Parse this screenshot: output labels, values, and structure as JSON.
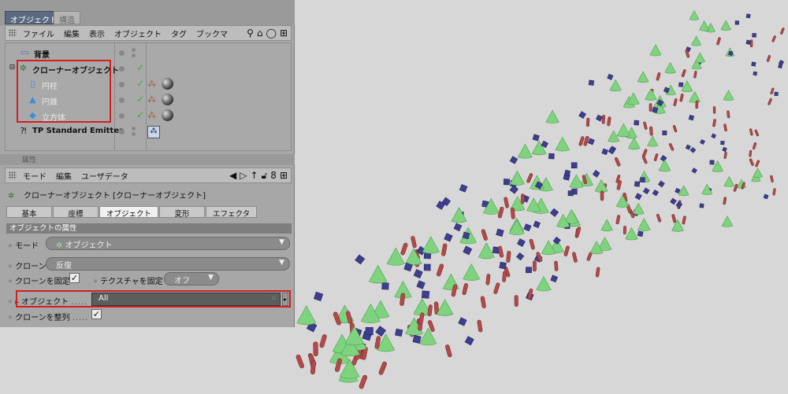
{
  "object_manager": {
    "tabs": [
      "オブジェクト",
      "構造"
    ],
    "menu": [
      "ファイル",
      "編集",
      "表示",
      "オブジェクト",
      "タグ",
      "ブックマ"
    ],
    "tree": [
      {
        "name": "背景",
        "icon": "background-icon"
      },
      {
        "name": "クローナーオブジェクト",
        "icon": "cloner-icon"
      },
      {
        "name": "円柱",
        "icon": "cylinder-icon"
      },
      {
        "name": "円錐",
        "icon": "cone-icon"
      },
      {
        "name": "立方体",
        "icon": "cube-icon"
      },
      {
        "name": "TP Standard Emitter",
        "icon": "emitter-icon"
      }
    ]
  },
  "attribute_manager": {
    "header": "属性",
    "menu": [
      "モード",
      "編集",
      "ユーザデータ"
    ],
    "title": "クローナーオブジェクト [クローナーオブジェクト]",
    "tabs": [
      "基本",
      "座標",
      "オブジェクト",
      "変形",
      "エフェクタ"
    ],
    "active_tab": "オブジェクト",
    "section_title": "オブジェクトの属性",
    "mode_label": "モード",
    "mode_value": "オブジェクト",
    "clone_label": "クローン",
    "clone_value": "反復",
    "fix_clone_label": "クローンを固定",
    "fix_texture_label": "テクスチャを固定",
    "fix_texture_value": "オフ",
    "object_label": "オブジェクト",
    "object_value": "All",
    "arrange_clone_label": "クローンを整列"
  },
  "colors": {
    "highlight_red": "#d21f1f",
    "cone_green": "#7fd37f",
    "cube_blue": "#3e3e8e",
    "cylinder_red": "#b24a4a"
  }
}
